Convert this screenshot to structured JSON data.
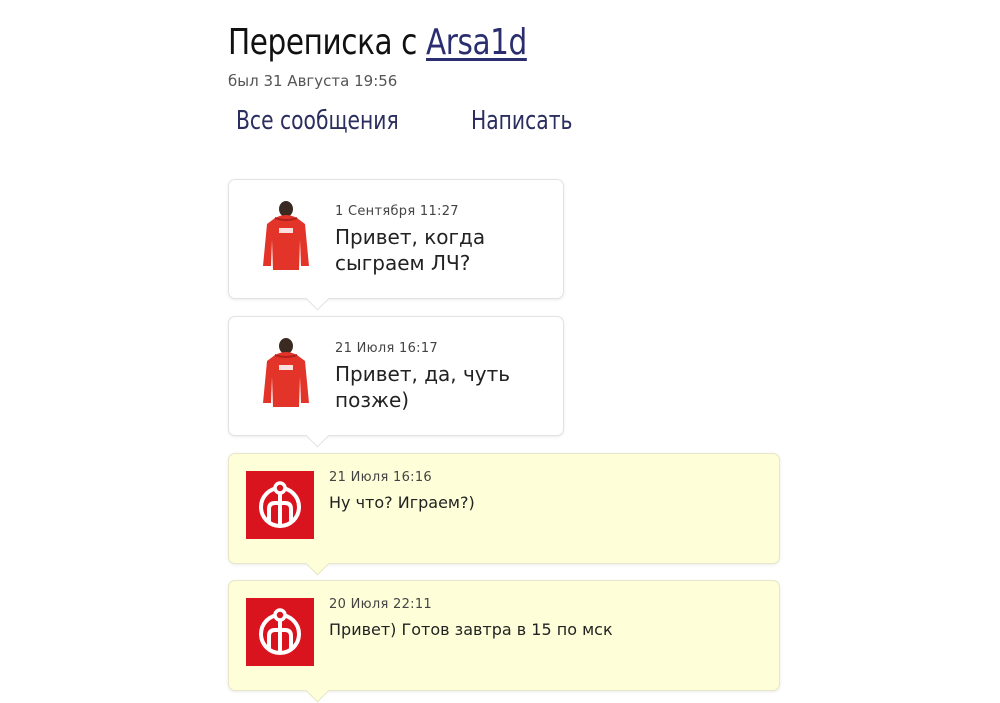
{
  "header": {
    "title_prefix": "Переписка с",
    "username": "Arsa1d",
    "last_seen": "был 31 Августа 19:56"
  },
  "nav": {
    "all_messages": "Все сообщения",
    "write": "Написать"
  },
  "messages": [
    {
      "direction": "incoming",
      "avatar": "red-jacket-avatar",
      "date": "1 Сентября 11:27",
      "text": "Привет, когда сыграем ЛЧ?"
    },
    {
      "direction": "incoming",
      "avatar": "red-jacket-avatar",
      "date": "21 Июля 16:17",
      "text": "Привет, да, чуть позже)"
    },
    {
      "direction": "outgoing",
      "avatar": "red-logo-avatar",
      "date": "21 Июля 16:16",
      "text": "Ну что? Играем?)"
    },
    {
      "direction": "outgoing",
      "avatar": "red-logo-avatar",
      "date": "20 Июля 22:11",
      "text": "Привет) Готов завтра в 15 по мск"
    }
  ],
  "colors": {
    "incoming_bg": "#ffffff",
    "outgoing_bg": "#fefed9",
    "avatar_red": "#d9141e",
    "link": "#2b2e6e"
  }
}
